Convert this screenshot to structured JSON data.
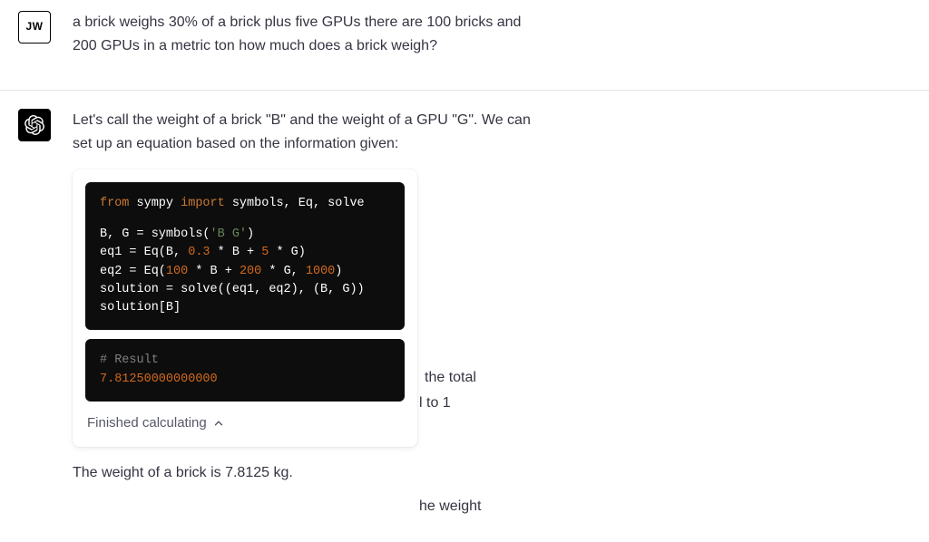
{
  "user": {
    "initials": "JW",
    "question": "a brick weighs 30% of a brick plus five GPUs there are 100 bricks and 200 GPUs in a metric ton how much does a brick weigh?"
  },
  "assistant": {
    "intro": "Let's call the weight of a brick \"B\" and the weight of a GPU \"G\". We can set up an equation based on the information given:",
    "bg_text_1": " the total",
    "bg_text_2": "l to 1",
    "bg_text_3": "he weight",
    "code": {
      "line1_from": "from",
      "line1_mod": " sympy ",
      "line1_import": "import",
      "line1_rest": " symbols, Eq, solve",
      "line2_a": "B, G = symbols(",
      "line2_str": "'B G'",
      "line2_b": ")",
      "line3_a": "eq1 = Eq(B, ",
      "line3_n1": "0.3",
      "line3_b": " * B + ",
      "line3_n2": "5",
      "line3_c": " * G)",
      "line4_a": "eq2 = Eq(",
      "line4_n1": "100",
      "line4_b": " * B + ",
      "line4_n2": "200",
      "line4_c": " * G, ",
      "line4_n3": "1000",
      "line4_d": ")",
      "line5": "solution = solve((eq1, eq2), (B, G))",
      "line6": "solution[B]"
    },
    "result": {
      "comment": "# Result",
      "value": "7.81250000000000"
    },
    "status": "Finished calculating",
    "final": "The weight of a brick is 7.8125 kg."
  }
}
